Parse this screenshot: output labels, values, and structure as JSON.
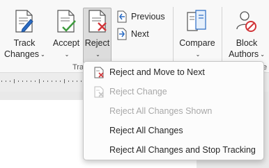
{
  "ribbon": {
    "track_changes": {
      "line1": "Track",
      "line2": "Changes",
      "chevron": "⌄"
    },
    "accept": {
      "line1": "Accept",
      "chevron": "⌄"
    },
    "reject": {
      "line1": "Reject",
      "chevron": "⌄"
    },
    "previous": {
      "label": "Previous"
    },
    "next": {
      "label": "Next"
    },
    "compare": {
      "line1": "Compare",
      "chevron": "⌄"
    },
    "block_authors": {
      "line1": "Block",
      "line2": "Authors",
      "chevron": "⌄"
    },
    "group_label_fragment": "Tra",
    "group_label_fragment_right": "te"
  },
  "reject_menu": {
    "items": [
      {
        "label": "Reject and Move to Next",
        "enabled": true,
        "icon": "reject-and-move-icon"
      },
      {
        "label": "Reject Change",
        "enabled": false,
        "icon": "reject-change-icon"
      },
      {
        "label": "Reject All Changes Shown",
        "enabled": false
      },
      {
        "label": "Reject All Changes",
        "enabled": true
      },
      {
        "label": "Reject All Changes and Stop Tracking",
        "enabled": true
      }
    ]
  },
  "colors": {
    "accent": "#2b6cc4",
    "reject_red": "#d13438",
    "accept_green": "#3c9b3c"
  }
}
